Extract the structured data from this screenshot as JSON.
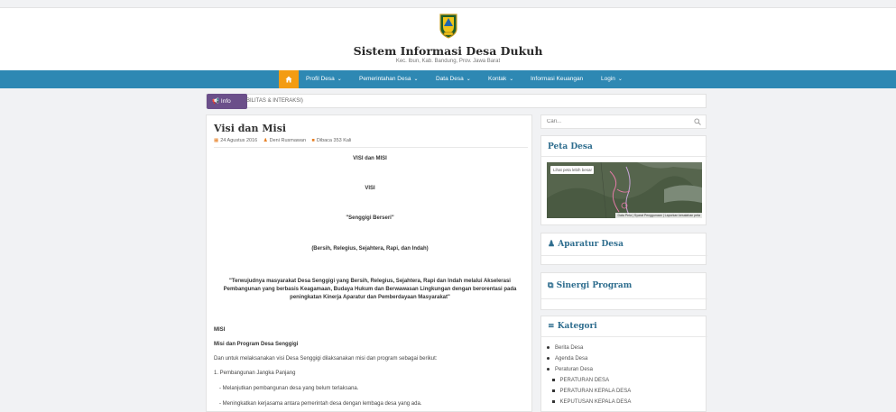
{
  "header": {
    "title": "Sistem Informasi Desa Dukuh",
    "subtitle": "Kec. Ibun, Kab. Bandung, Prov. Jawa Barat"
  },
  "nav": {
    "items": [
      {
        "label": "Profil Desa",
        "dropdown": true
      },
      {
        "label": "Pemerintahan Desa",
        "dropdown": true
      },
      {
        "label": "Data Desa",
        "dropdown": true
      },
      {
        "label": "Kontak",
        "dropdown": true
      },
      {
        "label": "Informasi Keuangan",
        "dropdown": false
      },
      {
        "label": "Login",
        "dropdown": true
      }
    ],
    "home_color": "#f39c12",
    "bar_color": "#2e88b3"
  },
  "info": {
    "button_label": "Info",
    "text": "BILITAS & INTERAKSI)"
  },
  "article": {
    "title": "Visi dan Misi",
    "date": "24 Agustus 2016",
    "author": "Deni Rusmawan",
    "views": "Dibaca 353 Kali",
    "heading": "VISI dan MISI",
    "visi_label": "VISI",
    "slogan": "\"Senggigi Berseri\"",
    "slogan_expansion": "(Bersih, Relegius, Sejahtera, Rapi, dan Indah)",
    "vision_statement": "\"Terwujudnya masyarakat Desa Senggigi yang Bersih, Relegius, Sejahtera, Rapi dan Indah melalui Akselerasi Pembangunan yang berbasis Keagamaan, Budaya Hukum dan Berwawasan Lingkungan dengan berorentasi pada peningkatan Kinerja Aparatur dan Pemberdayaan Masyarakat\"",
    "misi_label": "MISI",
    "misi_subheading": "Misi dan Program Desa Senggigi",
    "intro": "Dan untuk melaksanakan visi Desa Senggigi dilaksanakan misi dan program sebagai berikut:",
    "item_1": "1. Pembangunan Jangka Panjang",
    "item_1a": "- Melanjutkan pembangunan desa yang belum terlaksana.",
    "item_1b": "- Meningkatkan kerjasama antara pemerintah desa dengan lembaga desa yang ada."
  },
  "sidebar": {
    "search_placeholder": "Cari...",
    "peta_title": "Peta Desa",
    "map_button": "Lihat peta lebih besar",
    "map_footer": "Data Peta  |  Syarat Penggunaan  |  Laporkan kesalahan peta",
    "aparatur_title": "Aparatur Desa",
    "sinergi_title": "Sinergi Program",
    "kategori_title": "Kategori",
    "kategori": [
      "Berita Desa",
      "Agenda Desa",
      "Peraturan Desa"
    ],
    "kategori_sub": [
      "PERATURAN DESA",
      "PERATURAN KEPALA DESA",
      "KEPUTUSAN KEPALA DESA"
    ]
  }
}
